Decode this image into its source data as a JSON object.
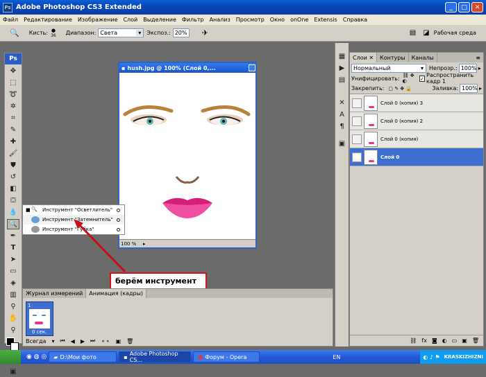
{
  "window": {
    "title": "Adobe Photoshop CS3 Extended",
    "app_badge": "Ps"
  },
  "menu": [
    "Файл",
    "Редактирование",
    "Изображение",
    "Слой",
    "Выделение",
    "Фильтр",
    "Анализ",
    "Просмотр",
    "Окно",
    "onOne",
    "Extensis",
    "Справка"
  ],
  "options": {
    "brush_label": "Кисть:",
    "brush_size": "36",
    "range_label": "Диапазон:",
    "range_value": "Света",
    "exposure_label": "Экспоз.:",
    "exposure_value": "20%",
    "workspace_label": "Рабочая среда"
  },
  "document": {
    "title": "hush.jpg @ 100% (Слой 0,...",
    "zoom": "100 %"
  },
  "flyout": [
    {
      "label": "Инструмент \"Осветлитель\"",
      "key": "O",
      "selected": false
    },
    {
      "label": "Инструмент \"Затемнитель\"",
      "key": "O",
      "selected": true
    },
    {
      "label": "Инструмент \"Губка\"",
      "key": "O",
      "selected": false
    }
  ],
  "callout": {
    "line1": "берём инструмент",
    "line2": "затемнитель"
  },
  "layers_panel": {
    "tabs": [
      "Слои",
      "Контуры",
      "Каналы"
    ],
    "blend_mode": "Нормальный",
    "opacity_label": "Непрозр.:",
    "opacity_value": "100%",
    "unify_label": "Унифицировать:",
    "propagate_label": "Распространить кадр 1",
    "lock_label": "Закрепить:",
    "fill_label": "Заливка:",
    "fill_value": "100%",
    "layers": [
      {
        "name": "Слой 0 (копия) 3",
        "active": false
      },
      {
        "name": "Слой 0 (копия) 2",
        "active": false
      },
      {
        "name": "Слой 0 (копия)",
        "active": false
      },
      {
        "name": "Слой 0",
        "active": true
      }
    ]
  },
  "history_panel": {
    "tabs": [
      "Журнал измерений",
      "Анимация (кадры)"
    ],
    "frame_number": "1",
    "frame_delay": "0 сек.",
    "loop": "Всегда"
  },
  "taskbar": {
    "tasks": [
      {
        "label": "D:\\Мои фото",
        "active": false
      },
      {
        "label": "Adobe Photoshop CS...",
        "active": true
      },
      {
        "label": "Форум - Opera",
        "active": false
      }
    ],
    "lang": "EN",
    "tray_text": "KRASKIZHIZNI"
  },
  "colors": {
    "accent": "#3e6fd0",
    "callout_border": "#d0101a",
    "arrow": "#c8101a"
  }
}
